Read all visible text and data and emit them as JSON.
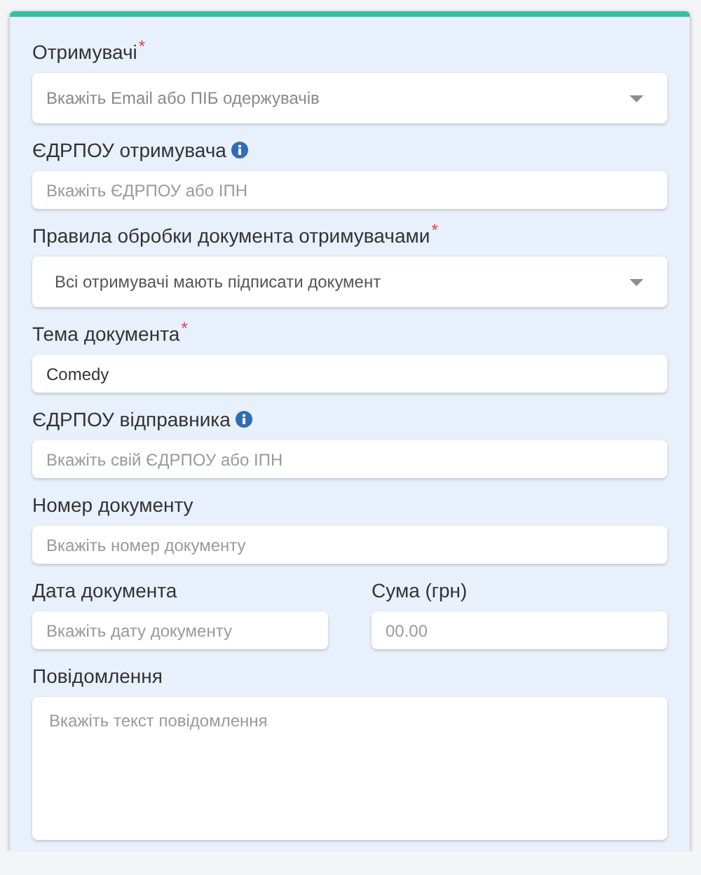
{
  "form": {
    "rows": [
      {
        "fields": [
          {
            "kind": "select",
            "label": "Отримувачі",
            "required_mark": "*",
            "info": false,
            "placeholder": "Вкажіть Email або ПІБ одержувачів"
          }
        ]
      },
      {
        "fields": [
          {
            "kind": "input",
            "label": "ЄДРПОУ отримувача",
            "info": true,
            "placeholder": "Вкажіть ЄДРПОУ або ІПН"
          }
        ]
      },
      {
        "fields": [
          {
            "kind": "select",
            "label": "Правила обробки документа отримувачами",
            "required_mark": "*",
            "info": false,
            "value": "Всі отримувачі мають підписати документ"
          }
        ]
      },
      {
        "fields": [
          {
            "kind": "input",
            "label": "Тема документа",
            "required_mark": "*",
            "info": false,
            "value": "Comedy"
          }
        ]
      },
      {
        "fields": [
          {
            "kind": "input",
            "label": "ЄДРПОУ відправника",
            "info": true,
            "placeholder": "Вкажіть свій ЄДРПОУ або ІПН"
          }
        ]
      },
      {
        "fields": [
          {
            "kind": "input",
            "label": "Номер документу",
            "info": false,
            "placeholder": "Вкажіть номер документу"
          }
        ]
      },
      {
        "fields": [
          {
            "kind": "input",
            "label": "Дата документа",
            "info": false,
            "placeholder": "Вкажіть дату документу"
          },
          {
            "kind": "input",
            "label": "Сума (грн)",
            "info": false,
            "placeholder": "00.00"
          }
        ]
      },
      {
        "fields": [
          {
            "kind": "textarea",
            "label": "Повідомлення",
            "info": false,
            "placeholder": "Вкажіть текст повідомлення"
          }
        ]
      }
    ]
  }
}
